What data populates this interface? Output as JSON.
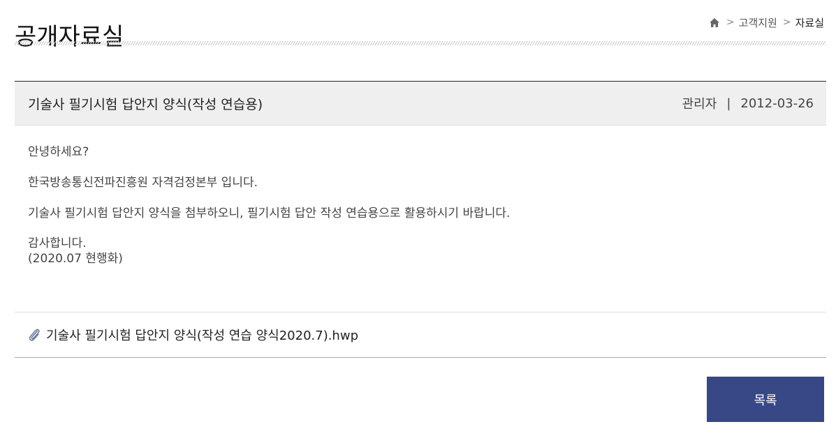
{
  "page": {
    "title": "공개자료실"
  },
  "breadcrumb": {
    "home_icon": "home-icon",
    "separator": ">",
    "items": [
      "고객지원",
      "자료실"
    ]
  },
  "post": {
    "title": "기술사 필기시험 답안지 양식(작성 연습용)",
    "author": "관리자",
    "meta_separator": "|",
    "date": "2012-03-26",
    "body": [
      "안녕하세요?",
      "한국방송통신전파진흥원 자격검정본부 입니다.",
      "기술사 필기시험 답안지 양식을 첨부하오니, 필기시험 답안 작성 연습용으로 활용하시기 바랍니다.",
      "감사합니다.",
      "(2020.07 현행화)"
    ],
    "attachment": {
      "icon": "paperclip-icon",
      "filename": "기술사 필기시험 답안지 양식(작성 연습 양식2020.7).hwp"
    }
  },
  "actions": {
    "list_label": "목록",
    "list_color": "#384785"
  },
  "colors": {
    "header_bg": "#efefef",
    "title_text": "#111111",
    "body_text": "#444444"
  }
}
